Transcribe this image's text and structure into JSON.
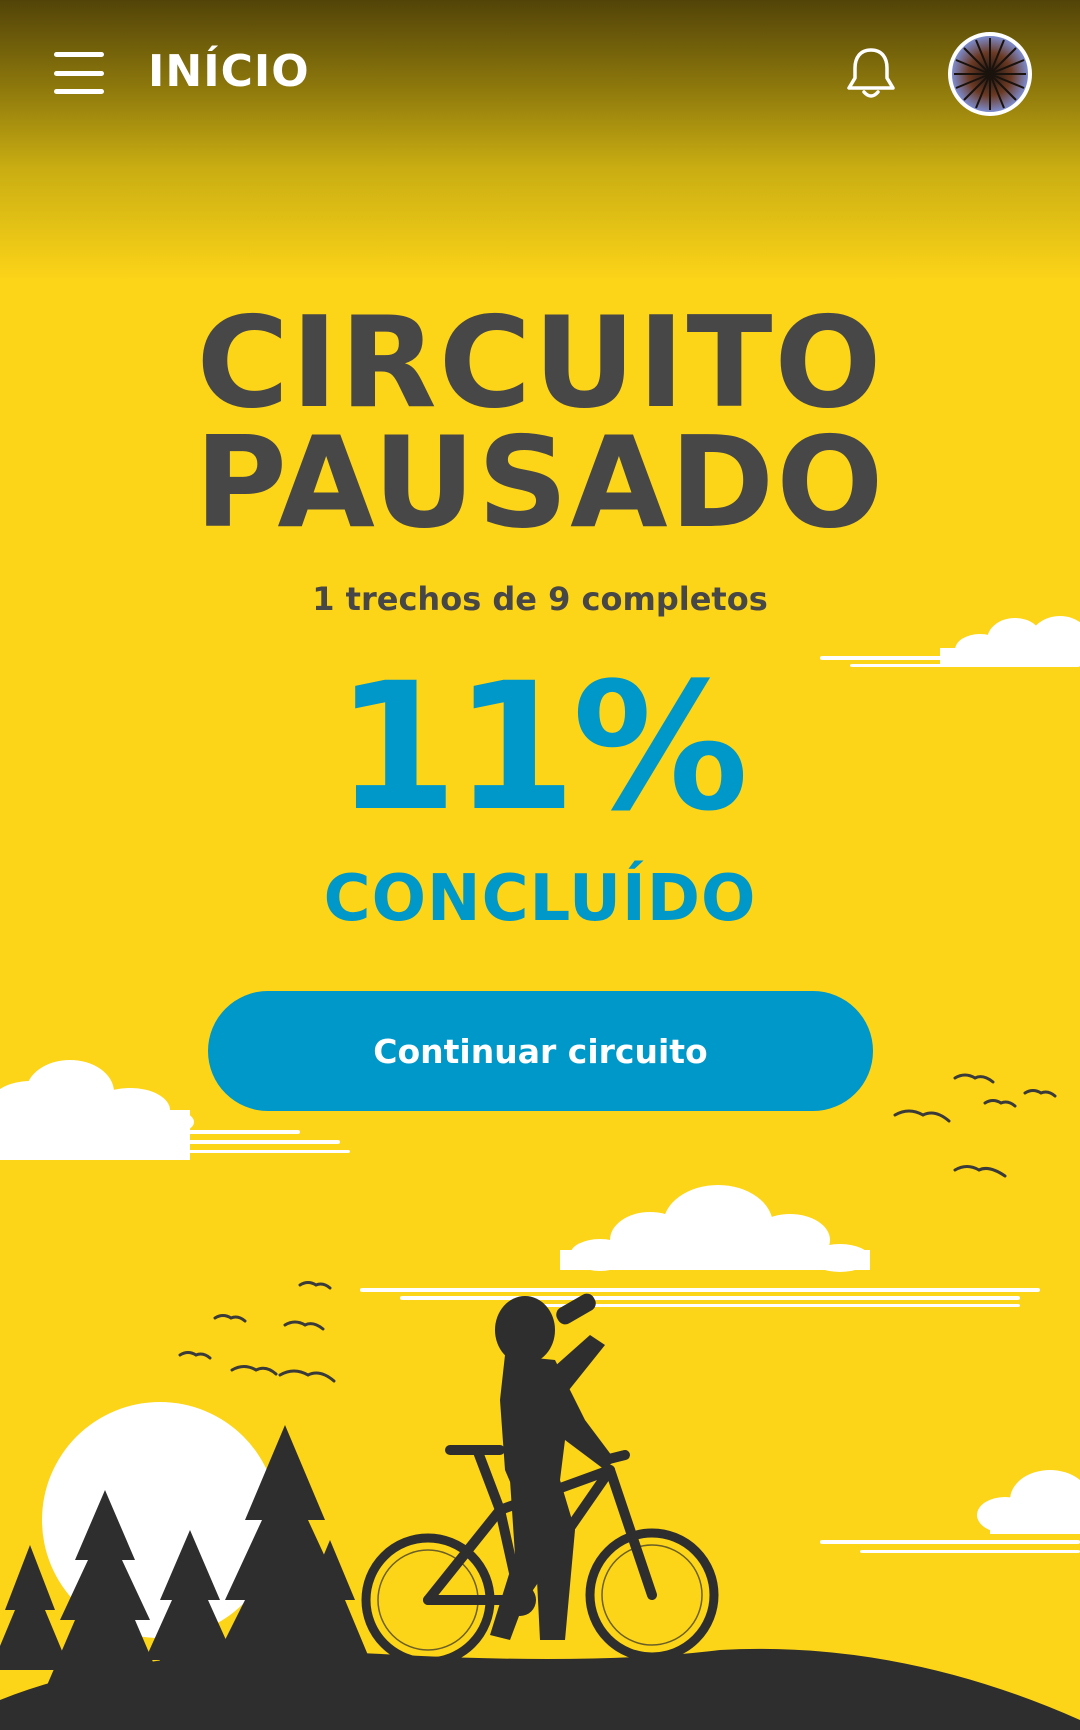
{
  "header": {
    "title": "INÍCIO",
    "menu_icon": "hamburger-menu-icon",
    "notification_icon": "bell-icon",
    "avatar_icon": "user-avatar"
  },
  "status": {
    "title_line1": "CIRCUITO",
    "title_line2": "PAUSADO",
    "progress_text": "1 trechos de 9 completos",
    "percent_text": "11%",
    "progress_value": 0.11,
    "completed_label": "CONCLUÍDO"
  },
  "actions": {
    "continue_label": "Continuar circuito"
  },
  "colors": {
    "background": "#FCD418",
    "accent": "#0097C9",
    "text_dark": "#474747",
    "silhouette": "#2E2E2E"
  }
}
